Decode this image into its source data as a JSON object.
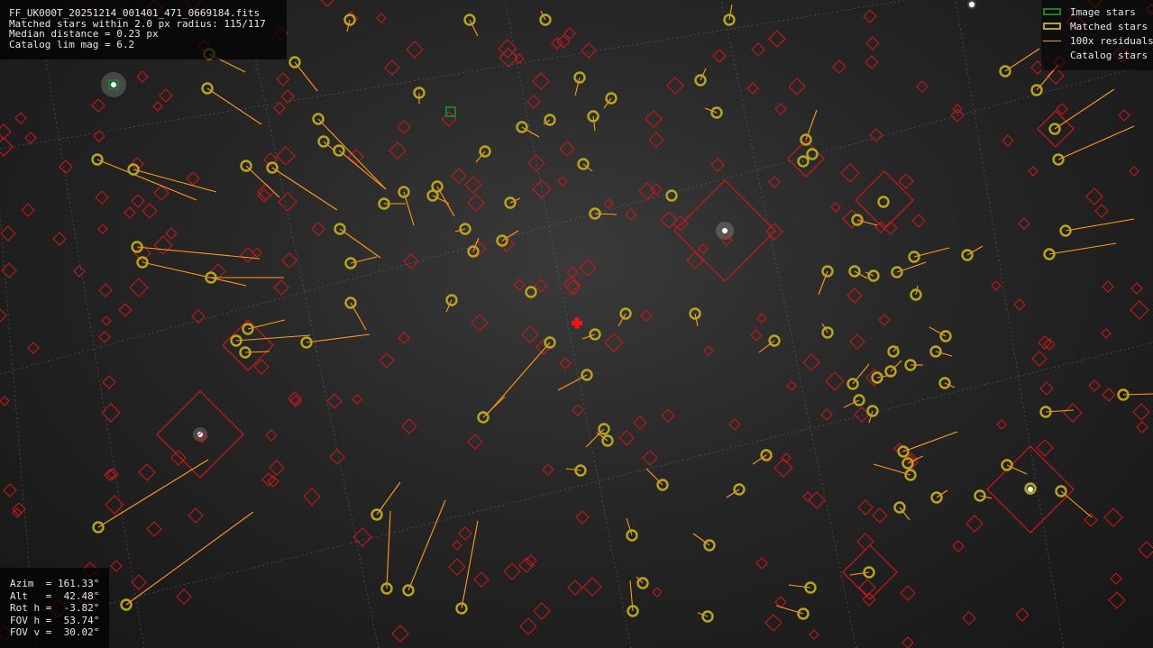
{
  "info": {
    "line1": "FF_UK000T_20251214_001401_471_0669184.fits",
    "line2": "Matched stars within 2.0 px radius: 115/117",
    "line3": "Median distance = 0.23 px",
    "line4": "Catalog lim mag = 6.2"
  },
  "legend": {
    "image_stars": "Image stars",
    "matched_stars": "Matched stars",
    "residuals": "100x residuals",
    "catalog_stars": "Catalog stars"
  },
  "params": {
    "azim": "Azim  = 161.33°",
    "alt": "Alt   =  42.48°",
    "rot": "Rot h =  -3.82°",
    "fov_h": "FOV h =  53.74°",
    "fov_v": "FOV v =  30.02°"
  },
  "colors": {
    "catalog": "#d01818",
    "matched": "#b8a61a",
    "image": "#1e7d2a",
    "residual": "#ff9a1a",
    "center_cross": "#ff1010"
  },
  "icons": {
    "center": "plus-cross-icon",
    "catalog_star": "diamond-icon",
    "matched_star": "ring-icon",
    "image_star": "square-icon"
  }
}
